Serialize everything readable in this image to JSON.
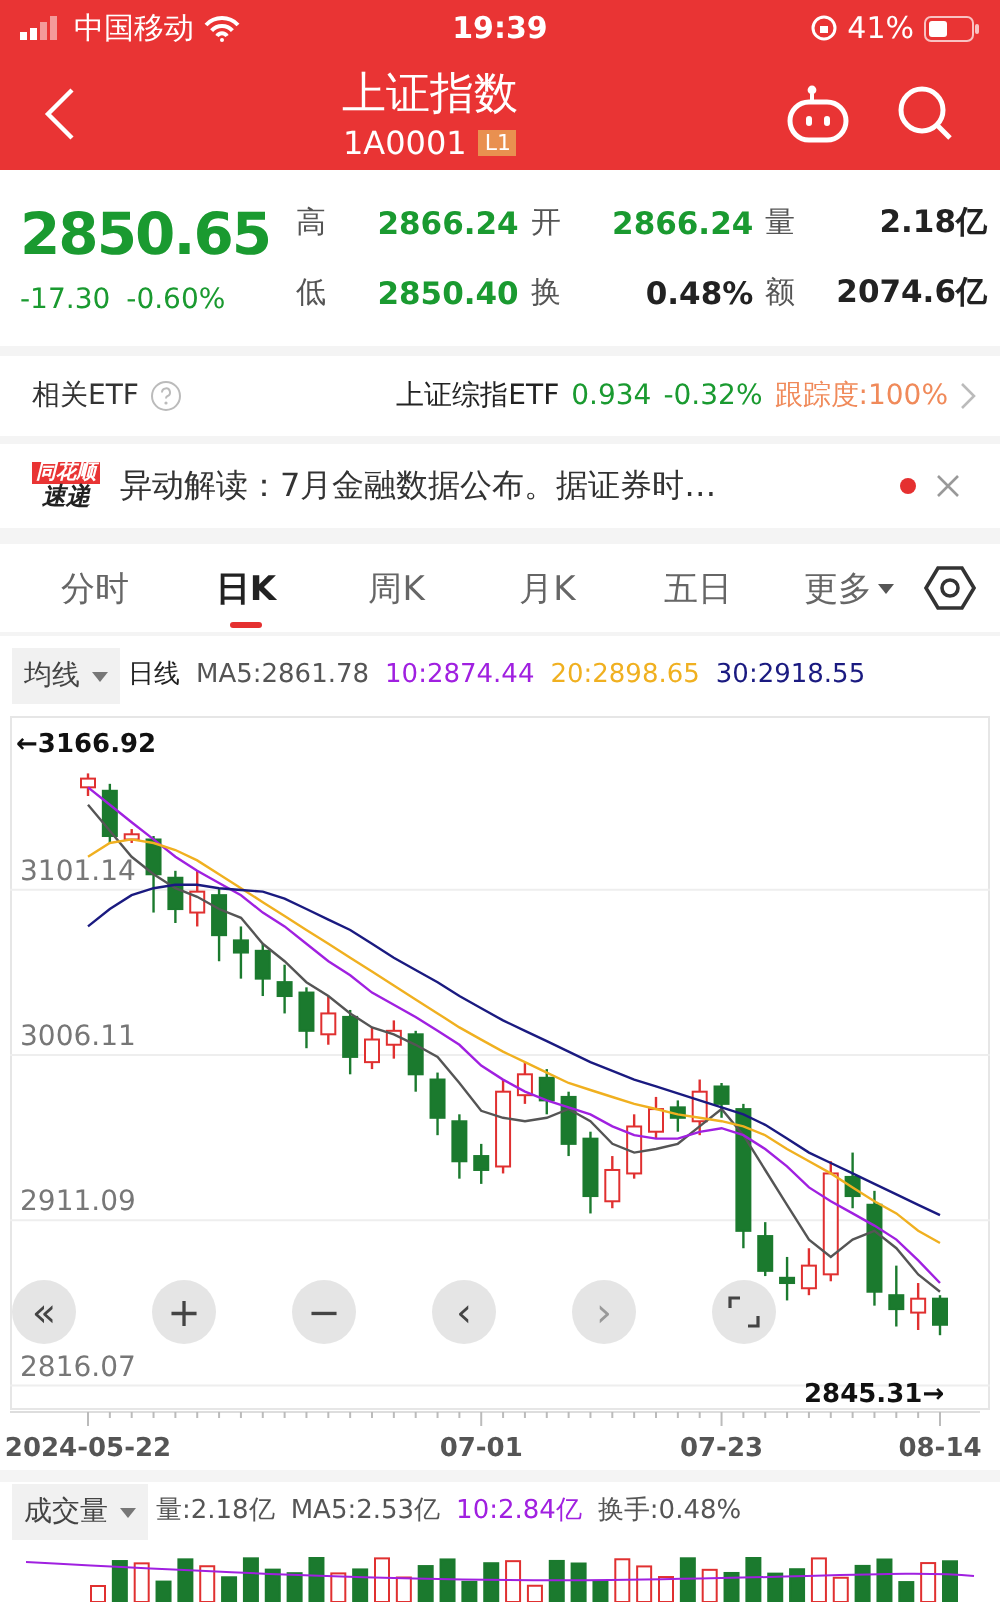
{
  "status_bar": {
    "carrier": "中国移动",
    "time": "19:39",
    "battery": "41%"
  },
  "header": {
    "title": "上证指数",
    "code": "1A0001",
    "badge": "L1"
  },
  "quote": {
    "price": "2850.65",
    "change": "-17.30",
    "change_pct": "-0.60%",
    "stats": [
      {
        "label": "高",
        "value": "2866.24",
        "color": "#1a9a30"
      },
      {
        "label": "开",
        "value": "2866.24",
        "color": "#1a9a30"
      },
      {
        "label": "量",
        "value": "2.18亿",
        "color": "#222222"
      },
      {
        "label": "低",
        "value": "2850.40",
        "color": "#1a9a30"
      },
      {
        "label": "换",
        "value": "0.48%",
        "color": "#222222"
      },
      {
        "label": "额",
        "value": "2074.6亿",
        "color": "#222222"
      }
    ]
  },
  "etf": {
    "label": "相关ETF",
    "name": "上证综指ETF",
    "price": "0.934",
    "change": "-0.32%",
    "tracking": "跟踪度:100%"
  },
  "news": {
    "logo_top": "同花顺",
    "logo_bottom": "速递",
    "text": "异动解读：7月金融数据公布。据证券时…",
    "unread": true
  },
  "tabs": [
    {
      "label": "分时",
      "selected": false
    },
    {
      "label": "日K",
      "selected": true
    },
    {
      "label": "周K",
      "selected": false
    },
    {
      "label": "月K",
      "selected": false
    },
    {
      "label": "五日",
      "selected": false
    },
    {
      "label": "更多",
      "selected": false
    }
  ],
  "ma_legend": {
    "selector": "均线",
    "title": "日线"
  },
  "chart": {
    "max_marker": "←3166.92",
    "min_marker": "2845.31→",
    "chart_data": {
      "type": "candlestick",
      "categories": [
        "2024-05-22",
        null,
        null,
        null,
        null,
        null,
        null,
        null,
        null,
        null,
        null,
        null,
        null,
        null,
        null,
        null,
        null,
        null,
        "07-01",
        null,
        null,
        null,
        null,
        null,
        null,
        null,
        null,
        null,
        null,
        "07-23",
        null,
        null,
        null,
        null,
        null,
        null,
        null,
        null,
        null,
        "08-14"
      ],
      "grid": true,
      "ylim": [
        2802,
        3201
      ],
      "yticks": [
        {
          "value": 3101.14,
          "label": "3101.14"
        },
        {
          "value": 3006.11,
          "label": "3006.11"
        },
        {
          "value": 2911.09,
          "label": "2911.09"
        },
        {
          "value": 2816.07,
          "label": "2816.07"
        }
      ],
      "ohlc": [
        [
          3160,
          3168,
          3155,
          3165
        ],
        [
          3158,
          3162,
          3128,
          3132
        ],
        [
          3130,
          3136,
          3128,
          3133
        ],
        [
          3130,
          3132,
          3088,
          3110
        ],
        [
          3108,
          3112,
          3082,
          3090
        ],
        [
          3088,
          3112,
          3080,
          3100
        ],
        [
          3098,
          3102,
          3060,
          3075
        ],
        [
          3072,
          3080,
          3050,
          3065
        ],
        [
          3066,
          3070,
          3040,
          3050
        ],
        [
          3048,
          3058,
          3030,
          3040
        ],
        [
          3042,
          3045,
          3010,
          3020
        ],
        [
          3018,
          3040,
          3012,
          3030
        ],
        [
          3028,
          3032,
          2995,
          3005
        ],
        [
          3002,
          3022,
          2998,
          3015
        ],
        [
          3012,
          3026,
          3004,
          3020
        ],
        [
          3018,
          3020,
          2985,
          2995
        ],
        [
          2992,
          2996,
          2960,
          2970
        ],
        [
          2968,
          2972,
          2935,
          2945
        ],
        [
          2948,
          2955,
          2932,
          2940
        ],
        [
          2942,
          2992,
          2938,
          2985
        ],
        [
          2983,
          3002,
          2978,
          2995
        ],
        [
          2993,
          2998,
          2972,
          2980
        ],
        [
          2982,
          2985,
          2948,
          2955
        ],
        [
          2958,
          2962,
          2915,
          2925
        ],
        [
          2922,
          2948,
          2918,
          2940
        ],
        [
          2938,
          2972,
          2935,
          2965
        ],
        [
          2962,
          2982,
          2958,
          2975
        ],
        [
          2976,
          2980,
          2962,
          2970
        ],
        [
          2968,
          2992,
          2960,
          2985
        ],
        [
          2988,
          2990,
          2970,
          2978
        ],
        [
          2975,
          2978,
          2895,
          2905
        ],
        [
          2902,
          2910,
          2879,
          2882
        ],
        [
          2878,
          2890,
          2865,
          2875
        ],
        [
          2872,
          2895,
          2868,
          2885
        ],
        [
          2880,
          2945,
          2876,
          2938
        ],
        [
          2936,
          2950,
          2918,
          2925
        ],
        [
          2920,
          2928,
          2862,
          2870
        ],
        [
          2868,
          2885,
          2850,
          2860
        ],
        [
          2858,
          2875,
          2848,
          2866
        ],
        [
          2866,
          2868,
          2845,
          2851
        ]
      ],
      "series": [
        {
          "name": "MA5:2861.78",
          "type": "line",
          "color": "#555555",
          "values": [
            3150,
            3135,
            3120,
            3110,
            3102,
            3097,
            3090,
            3085,
            3070,
            3060,
            3048,
            3040,
            3030,
            3022,
            3018,
            3012,
            3005,
            2990,
            2974,
            2970,
            2968,
            2970,
            2975,
            2968,
            2955,
            2950,
            2952,
            2955,
            2965,
            2975,
            2960,
            2940,
            2920,
            2900,
            2890,
            2900,
            2905,
            2895,
            2880,
            2870
          ]
        },
        {
          "name": "10:2874.44",
          "type": "line",
          "color": "#a020e0",
          "values": [
            3160,
            3150,
            3140,
            3130,
            3120,
            3112,
            3105,
            3098,
            3088,
            3080,
            3070,
            3060,
            3052,
            3042,
            3035,
            3028,
            3020,
            3012,
            3000,
            2992,
            2985,
            2980,
            2976,
            2972,
            2965,
            2960,
            2958,
            2958,
            2962,
            2964,
            2960,
            2952,
            2942,
            2930,
            2922,
            2915,
            2908,
            2900,
            2888,
            2875
          ]
        },
        {
          "name": "20:2898.65",
          "type": "line",
          "color": "#f0b020",
          "values": [
            3120,
            3128,
            3130,
            3128,
            3124,
            3118,
            3110,
            3102,
            3094,
            3086,
            3078,
            3070,
            3062,
            3054,
            3046,
            3038,
            3030,
            3022,
            3015,
            3008,
            3002,
            2996,
            2990,
            2986,
            2982,
            2978,
            2975,
            2972,
            2970,
            2968,
            2965,
            2960,
            2952,
            2945,
            2938,
            2930,
            2922,
            2915,
            2905,
            2898
          ]
        },
        {
          "name": "30:2918.55",
          "type": "line",
          "color": "#1a1a80",
          "values": [
            3080,
            3090,
            3098,
            3102,
            3104,
            3104,
            3102,
            3101,
            3100,
            3096,
            3090,
            3084,
            3078,
            3070,
            3062,
            3055,
            3048,
            3040,
            3033,
            3026,
            3020,
            3014,
            3008,
            3002,
            2997,
            2992,
            2988,
            2984,
            2980,
            2976,
            2972,
            2966,
            2958,
            2950,
            2944,
            2938,
            2932,
            2926,
            2920,
            2914
          ]
        }
      ]
    },
    "controls": [
      {
        "symbol": "«",
        "disabled": false
      },
      {
        "symbol": "+",
        "disabled": false
      },
      {
        "symbol": "−",
        "disabled": false
      },
      {
        "symbol": "‹",
        "disabled": false
      },
      {
        "symbol": "›",
        "disabled": true
      }
    ]
  },
  "volume_legend": {
    "selector": "成交量",
    "items": [
      {
        "text": "量:2.18亿",
        "color": "#555555"
      },
      {
        "text": "MA5:2.53亿",
        "color": "#555555"
      },
      {
        "text": "10:2.84亿",
        "color": "#a020e0"
      },
      {
        "text": "换手:0.48%",
        "color": "#555555"
      }
    ]
  }
}
